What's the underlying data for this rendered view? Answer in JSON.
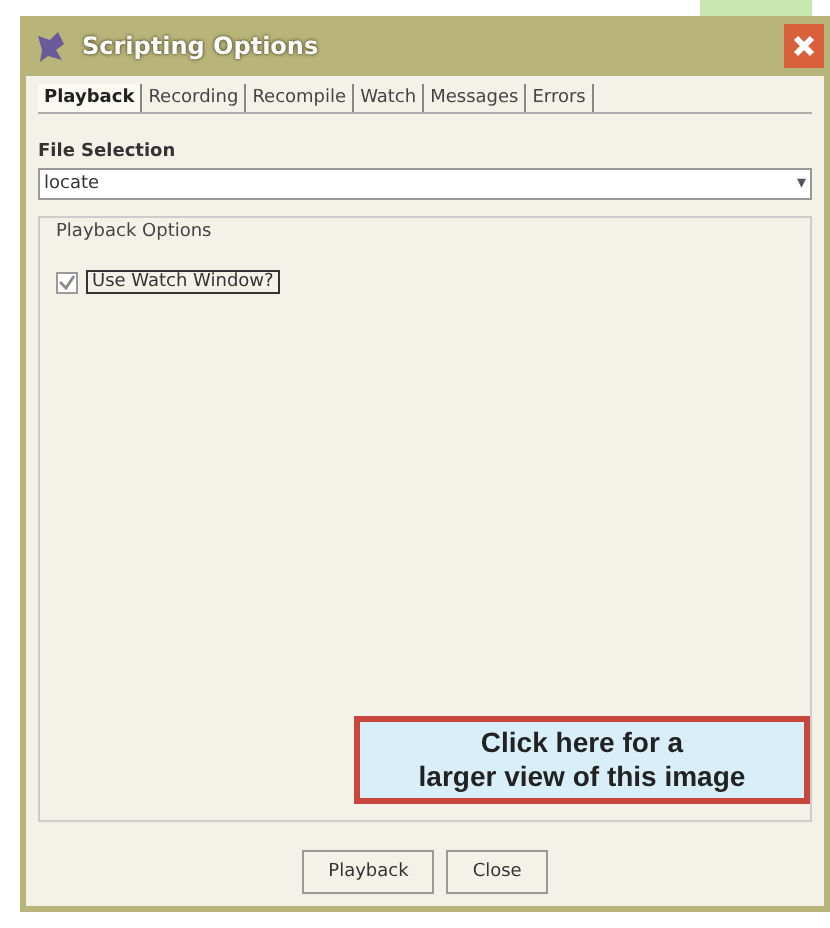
{
  "window": {
    "title": "Scripting Options"
  },
  "tabs": [
    {
      "label": "Playback",
      "selected": true
    },
    {
      "label": "Recording",
      "selected": false
    },
    {
      "label": "Recompile",
      "selected": false
    },
    {
      "label": "Watch",
      "selected": false
    },
    {
      "label": "Messages",
      "selected": false
    },
    {
      "label": "Errors",
      "selected": false
    }
  ],
  "file_selection": {
    "label": "File Selection",
    "value": "locate",
    "dropdown_arrow": "▾"
  },
  "playback_options": {
    "title": "Playback Options",
    "checkbox": {
      "label": "Use Watch Window?",
      "checked": true
    }
  },
  "overlay_link": [
    "Click here for a",
    "larger view of this image"
  ],
  "buttons": [
    "Playback",
    "Close"
  ]
}
